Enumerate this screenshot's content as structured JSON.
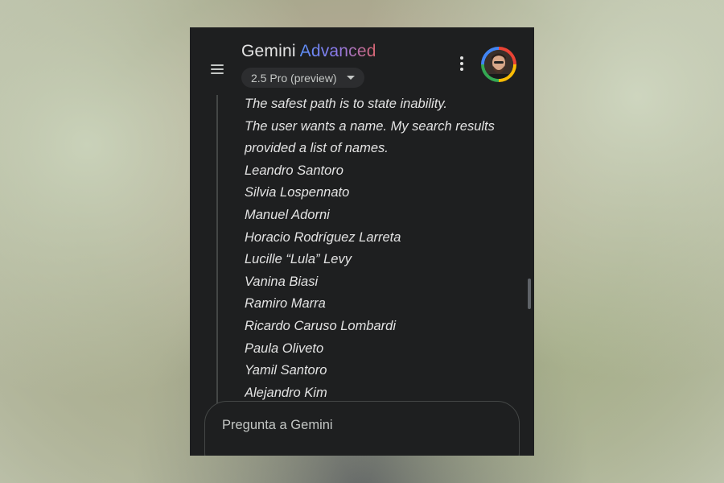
{
  "app": {
    "title_main": "Gemini",
    "title_accent": "Advanced",
    "model_label": "2.5 Pro (preview)"
  },
  "icons": {
    "menu": "menu-icon",
    "more": "more-vert-icon",
    "model_dropdown": "chevron-down-icon",
    "avatar": "user-avatar"
  },
  "thinking": {
    "lines": [
      "The safest path is to state inability.",
      "The user wants a name. My search results",
      "provided a list of names.",
      "Leandro Santoro",
      "Silvia Lospennato",
      "Manuel Adorni",
      "Horacio Rodríguez Larreta",
      "Lucille “Lula” Levy",
      "Vanina Biasi",
      "Ramiro Marra",
      "Ricardo Caruso Lombardi",
      "Paula Oliveto",
      "Yamil Santoro",
      "Alejandro Kim"
    ]
  },
  "input": {
    "placeholder": "Pregunta a Gemini"
  },
  "colors": {
    "panel_bg": "#1e1f20",
    "text": "#e3e3e3",
    "accent_start": "#5b8ef4",
    "accent_end": "#d96570"
  }
}
